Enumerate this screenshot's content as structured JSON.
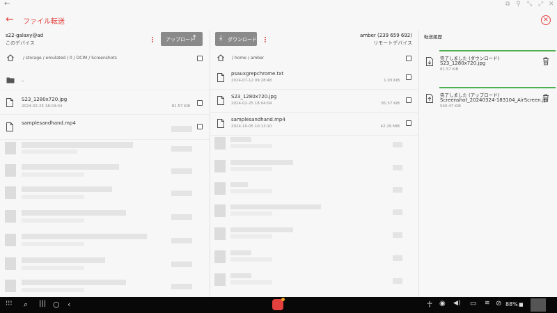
{
  "app": {
    "title": "ファイル転送",
    "back_glyph": "←",
    "close_glyph": "✕"
  },
  "local": {
    "device_name": "s22-galaxy@ad",
    "device_label": "このデバイス",
    "upload_label": "アップロード",
    "path": "/ storage / emulated / 0 / DCIM / Screenshots",
    "parent_dir": "..",
    "files": [
      {
        "name": "S23_1280x720.jpg",
        "date": "2024-02-25 18:04:04",
        "size": "81.57 KiB"
      },
      {
        "name": "samplesandhand.mp4",
        "date": "",
        "size": ""
      }
    ]
  },
  "remote": {
    "download_label": "ダウンロード",
    "device_name": "amber (239 659 692)",
    "device_label": "リモートデバイス",
    "path": "/ home / amber",
    "files": [
      {
        "name": "psauxgrepchrome.txt",
        "date": "2024-07-12 09:28:48",
        "size": "1.03 KiB"
      },
      {
        "name": "S23_1280x720.jpg",
        "date": "2024-02-25 18:04:04",
        "size": "81.57 KiB"
      },
      {
        "name": "samplesandhand.mp4",
        "date": "2024-10-05 10:13:10",
        "size": "42.29 MiB"
      }
    ]
  },
  "history": {
    "title": "転送履歴",
    "items": [
      {
        "status": "完了しました (ダウンロード)",
        "name": "S23_1280x720.jpg",
        "size": "81.57 KiB",
        "direction": "download"
      },
      {
        "status": "完了しました (アップロード)",
        "name": "Screenshot_20240324-183104_AirScreen.jp",
        "size": "540.47 KiB",
        "direction": "upload"
      }
    ]
  },
  "taskbar": {
    "battery": "88%",
    "icons": [
      "apps-grid-icon",
      "search-icon",
      "recents-icon",
      "home-icon",
      "back-icon",
      "accessibility-icon",
      "screen-record-icon",
      "volume-icon",
      "message-icon",
      "wifi-icon",
      "dnd-icon",
      "battery-icon"
    ]
  },
  "colors": {
    "accent": "#e2413d",
    "progress": "#4caf50",
    "button_bg": "#8a8a8a"
  }
}
